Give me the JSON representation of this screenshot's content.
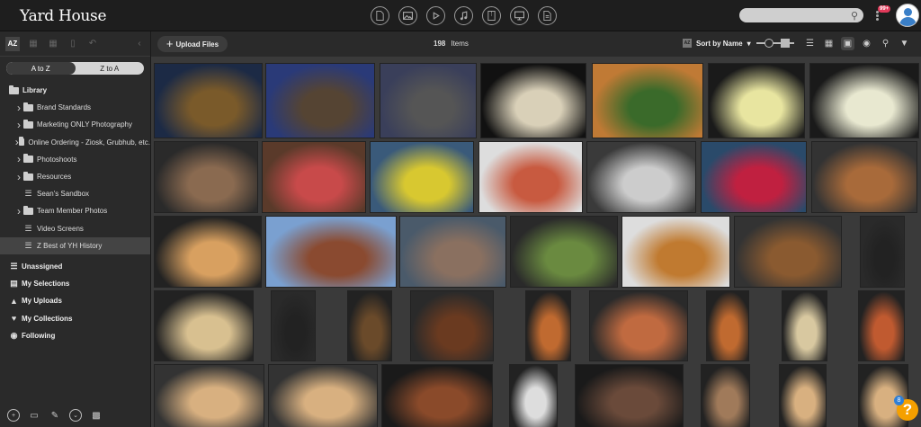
{
  "header": {
    "logo": "Yard House",
    "notification_badge": "99+",
    "type_filters": [
      "document-icon",
      "image-icon",
      "video-icon",
      "audio-icon",
      "archive-icon",
      "presentation-icon",
      "other-file-icon"
    ]
  },
  "sidebar": {
    "tools": [
      "AZ",
      "",
      "",
      "",
      "",
      ""
    ],
    "sort_toggle": {
      "a_to_z": "A to Z",
      "z_to_a": "Z to A"
    },
    "library_label": "Library",
    "items": [
      {
        "label": "Brand Standards",
        "type": "folder",
        "expandable": true
      },
      {
        "label": "Marketing ONLY Photography",
        "type": "folder",
        "expandable": true
      },
      {
        "label": "Online Ordering - Ziosk, Grubhub, etc.",
        "type": "folder",
        "expandable": true
      },
      {
        "label": "Photoshoots",
        "type": "folder",
        "expandable": true
      },
      {
        "label": "Resources",
        "type": "folder",
        "expandable": true
      },
      {
        "label": "Sean's Sandbox",
        "type": "collection",
        "expandable": false
      },
      {
        "label": "Team Member Photos",
        "type": "folder",
        "expandable": true
      },
      {
        "label": "Video Screens",
        "type": "collection",
        "expandable": false
      },
      {
        "label": "Z Best of YH History",
        "type": "collection",
        "expandable": false,
        "selected": true
      }
    ],
    "sections": [
      "Unassigned",
      "My Selections",
      "My Uploads",
      "My Collections",
      "Following"
    ]
  },
  "toolbar": {
    "upload_label": "Upload Files",
    "item_count": "198",
    "items_label": "Items",
    "sort_label": "Sort by Name"
  },
  "help": {
    "badge": "8",
    "label": "?"
  },
  "colors": {
    "accent_badge": "#e23a5a",
    "help": "#f5a000",
    "help_badge": "#2f7fd6"
  }
}
